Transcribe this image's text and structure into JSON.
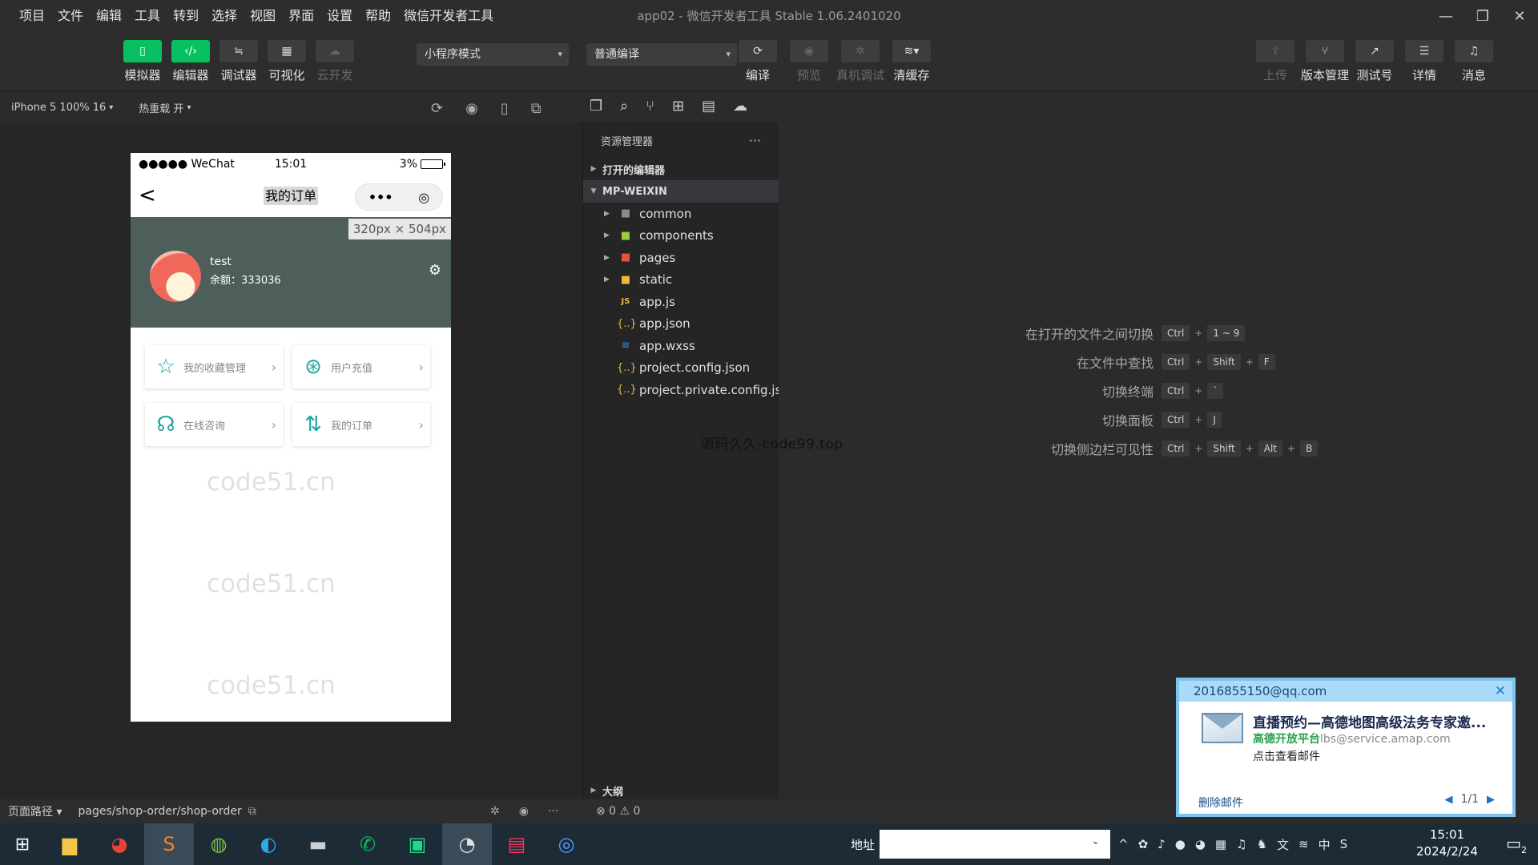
{
  "window": {
    "title": "app02 - 微信开发者工具 Stable 1.06.2401020",
    "menu": [
      "项目",
      "文件",
      "编辑",
      "工具",
      "转到",
      "选择",
      "视图",
      "界面",
      "设置",
      "帮助",
      "微信开发者工具"
    ]
  },
  "toolbar": {
    "left": [
      {
        "label": "模拟器",
        "icon": "phone-icon"
      },
      {
        "label": "编辑器",
        "icon": "code-icon"
      },
      {
        "label": "调试器",
        "icon": "debug-icon"
      },
      {
        "label": "可视化",
        "icon": "layout-icon"
      },
      {
        "label": "云开发",
        "icon": "cloud-icon"
      }
    ],
    "mode_select": "小程序模式",
    "compile_select": "普通编译",
    "mid": [
      {
        "label": "编译",
        "icon": "refresh-icon"
      },
      {
        "label": "预览",
        "icon": "eye-icon"
      },
      {
        "label": "真机调试",
        "icon": "bug-icon"
      },
      {
        "label": "清缓存",
        "icon": "layers-icon"
      }
    ],
    "right": [
      {
        "label": "上传",
        "icon": "upload-icon"
      },
      {
        "label": "版本管理",
        "icon": "branch-icon"
      },
      {
        "label": "测试号",
        "icon": "external-icon"
      },
      {
        "label": "详情",
        "icon": "menu-icon"
      },
      {
        "label": "消息",
        "icon": "bell-icon"
      }
    ]
  },
  "simulator": {
    "device": "iPhone 5 100% 16",
    "hot_reload": "热重载 开",
    "status": {
      "carrier": "●●●●● WeChat",
      "time": "15:01",
      "battery": "3%"
    },
    "nav_title": "我的订单",
    "capsule_dots": "•••",
    "size_tag": "320px × 504px",
    "profile": {
      "username": "test",
      "balance": "余额：333036"
    },
    "cards": [
      {
        "label": "我的收藏管理",
        "icon": "star-icon"
      },
      {
        "label": "用户充值",
        "icon": "wallet-icon"
      },
      {
        "label": "在线咨询",
        "icon": "support-icon"
      },
      {
        "label": "我的订单",
        "icon": "sort-icon"
      }
    ]
  },
  "explorer": {
    "header": "资源管理器",
    "open_editors": "打开的编辑器",
    "project": "MP-WEIXIN",
    "folders": [
      {
        "name": "common",
        "color": "#8a8a8a"
      },
      {
        "name": "components",
        "color": "#9bcc3a"
      },
      {
        "name": "pages",
        "color": "#e5533b"
      },
      {
        "name": "static",
        "color": "#e7bb3d"
      }
    ],
    "files": [
      {
        "name": "app.js",
        "type": "js"
      },
      {
        "name": "app.json",
        "type": "json"
      },
      {
        "name": "app.wxss",
        "type": "css"
      },
      {
        "name": "project.config.json",
        "type": "json"
      },
      {
        "name": "project.private.config.js...",
        "type": "json"
      }
    ],
    "outline": "大纲"
  },
  "editor": {
    "shortcuts": [
      {
        "label": "在打开的文件之间切换",
        "keys": [
          "Ctrl",
          "1 ~ 9"
        ]
      },
      {
        "label": "在文件中查找",
        "keys": [
          "Ctrl",
          "Shift",
          "F"
        ]
      },
      {
        "label": "切换终端",
        "keys": [
          "Ctrl",
          "`"
        ]
      },
      {
        "label": "切换面板",
        "keys": [
          "Ctrl",
          "J"
        ]
      },
      {
        "label": "切换侧边栏可见性",
        "keys": [
          "Ctrl",
          "Shift",
          "Alt",
          "B"
        ]
      }
    ],
    "center_text": "源码久久-code99.top"
  },
  "watermark": "code51.cn",
  "statusbar": {
    "path_label": "页面路径 ▾",
    "path": "pages/shop-order/shop-order",
    "errors": "⊗ 0 ⚠ 0"
  },
  "notification": {
    "email": "2016855150@qq.com",
    "subject": "直播预约—高德地图高级法务专家邀...",
    "from_name": "高德开放平台",
    "from_addr": "lbs@service.amap.com",
    "view": "点击查看邮件",
    "delete": "删除邮件",
    "page": "1/1"
  },
  "taskbar": {
    "address_label": "地址",
    "time": "15:01",
    "date": "2024/2/24",
    "notif_count": "2",
    "ime": "中"
  }
}
